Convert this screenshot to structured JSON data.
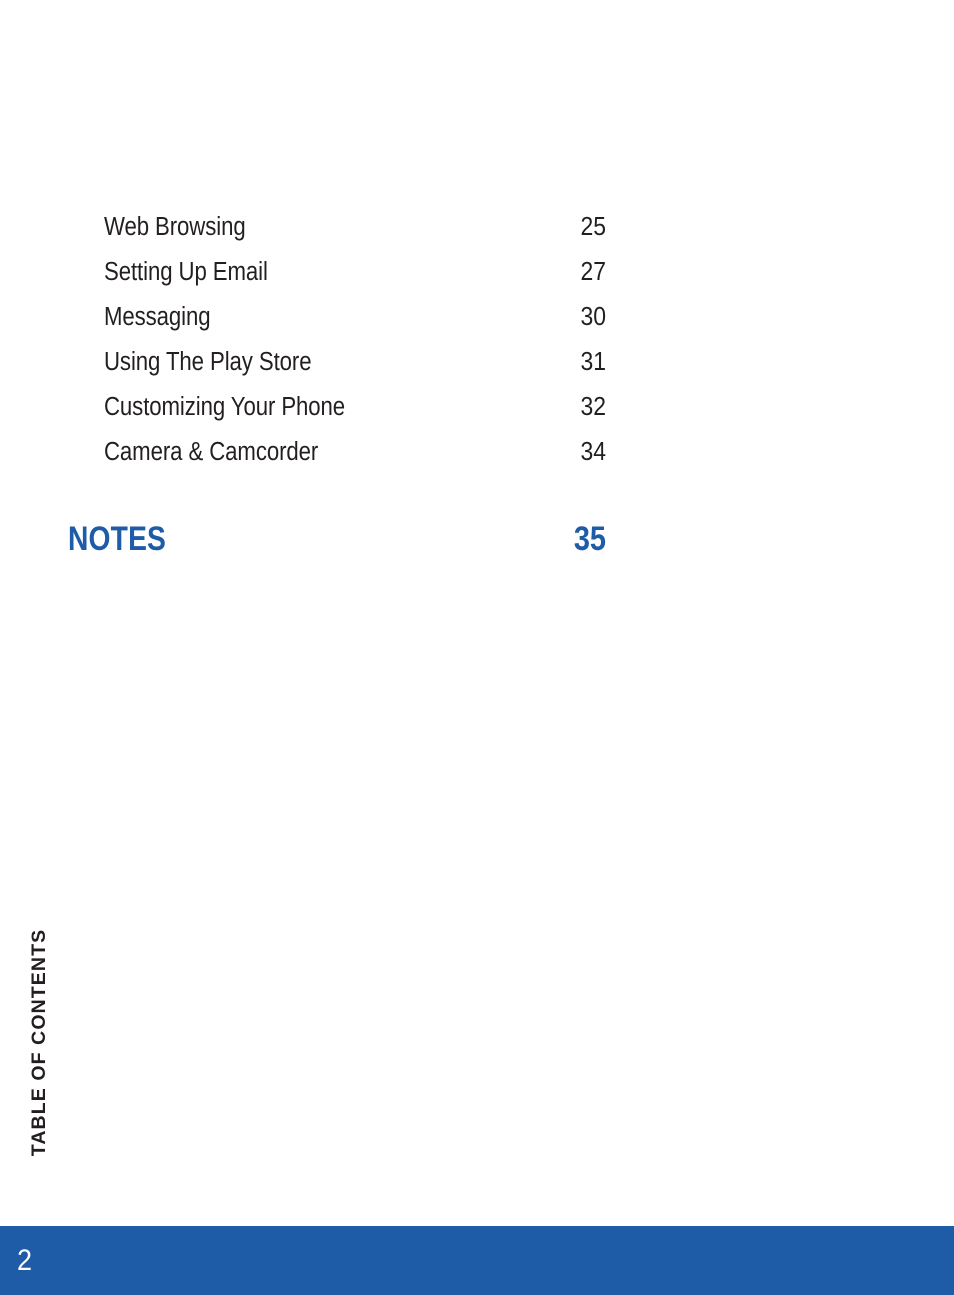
{
  "document": {
    "section_tab_label": "TABLE OF CONTENTS",
    "page_number": "2",
    "colors": {
      "brand_blue": "#1F5CA8",
      "body_text": "#231F20",
      "page_background": "#FFFFFF",
      "footer_text": "#FFFFFF"
    }
  },
  "toc": {
    "entries": [
      {
        "label": "Web Browsing",
        "page": "25"
      },
      {
        "label": "Setting Up Email",
        "page": "27"
      },
      {
        "label": "Messaging",
        "page": "30"
      },
      {
        "label": "Using The Play Store",
        "page": "31"
      },
      {
        "label": "Customizing Your Phone",
        "page": "32"
      },
      {
        "label": "Camera & Camcorder",
        "page": "34"
      }
    ],
    "section_heading": {
      "label": "NOTES",
      "page": "35"
    }
  }
}
